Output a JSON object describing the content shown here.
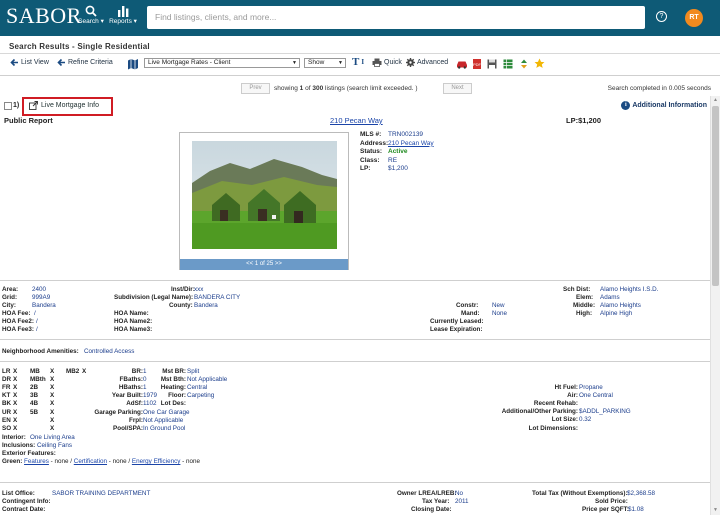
{
  "header": {
    "logo": "SABOR",
    "search_nav_label": "Search",
    "reports_nav_label": "Reports",
    "search_placeholder": "Find listings, clients, and more...",
    "help_label": "?",
    "avatar_initials": "RT",
    "bar_color": "#0e5a76",
    "avatar_color": "#f18a1e"
  },
  "page_title": "Search Results - Single Residential",
  "toolbar": {
    "list_view": "List View",
    "refine_criteria": "Refine Criteria",
    "report_select": "Live Mortgage Rates - Client",
    "show_select": "Show",
    "quick": "Quick",
    "advanced": "Advanced"
  },
  "pager": {
    "prev": "Prev",
    "next": "Next",
    "showing_pre": "showing",
    "current": "1",
    "of": "of",
    "total": "300",
    "showing_post": "listings (search limit exceeded. )",
    "completed": "Search completed in 0.005 seconds"
  },
  "result": {
    "row_number": "1)",
    "live_mortgage": "Live Mortgage Info",
    "additional_info": "Additional Information",
    "report_title": "Public Report",
    "address_link": "210 Pecan Way",
    "lp_header": "LP:$1,200",
    "photo_counter": "<< 1 of 25 >>",
    "facts": [
      {
        "k": "MLS #:",
        "v": "TRN002139",
        "style": "v"
      },
      {
        "k": "Address:",
        "v": "210 Pecan Way",
        "style": "lnk"
      },
      {
        "k": "Status:",
        "v": "Active",
        "style": "active"
      },
      {
        "k": "Class:",
        "v": "RE",
        "style": "v"
      },
      {
        "k": "LP:",
        "v": "$1,200",
        "style": "v"
      }
    ]
  },
  "section1": {
    "area_k": "Area:",
    "area_v": "2400",
    "grid_k": "Grid:",
    "grid_v": "999A9",
    "city_k": "City:",
    "city_v": "Bandera",
    "hoafee_k": "HOA Fee:",
    "hoafee_v": "/",
    "hoafee2_k": "HOA Fee2:",
    "hoafee2_v": "/",
    "hoafee3_k": "HOA Fee3:",
    "hoafee3_v": "/",
    "instdir_k": "Inst/Dir:",
    "instdir_v": "xxx",
    "subdiv_k": "Subdivision (Legal Name):",
    "subdiv_v": "BANDERA CITY",
    "county_k": "County:",
    "county_v": "Bandera",
    "hoaname_k": "HOA Name:",
    "hoaname2_k": "HOA Name2:",
    "hoaname3_k": "HOA Name3:",
    "constr_k": "Constr:",
    "constr_v": "New",
    "mand_k": "Mand:",
    "mand_v": "None",
    "leased_k": "Currently Leased:",
    "leaseexp_k": "Lease Expiration:",
    "schdist_k": "Sch Dist:",
    "schdist_v": "Alamo Heights I.S.D.",
    "elem_k": "Elem:",
    "elem_v": "Adams",
    "middle_k": "Middle:",
    "middle_v": "Alamo Heights",
    "high_k": "High:",
    "high_v": "Alpine High"
  },
  "section2": {
    "amen_k": "Neighborhood Amenities:",
    "amen_v": "Controlled Access"
  },
  "rooms": [
    {
      "a": "LR",
      "b": "X",
      "c": "MB",
      "d": "X",
      "e": "MB2",
      "f": "X"
    },
    {
      "a": "DR",
      "b": "X",
      "c": "MBth",
      "d": "X",
      "e": "",
      "f": ""
    },
    {
      "a": "FR",
      "b": "X",
      "c": "2B",
      "d": "X",
      "e": "",
      "f": ""
    },
    {
      "a": "KT",
      "b": "X",
      "c": "3B",
      "d": "X",
      "e": "",
      "f": ""
    },
    {
      "a": "BK",
      "b": "X",
      "c": "4B",
      "d": "X",
      "e": "",
      "f": ""
    },
    {
      "a": "UR",
      "b": "X",
      "c": "5B",
      "d": "X",
      "e": "",
      "f": ""
    },
    {
      "a": "EN",
      "b": "X",
      "c": "",
      "d": "X",
      "e": "",
      "f": ""
    },
    {
      "a": "SO",
      "b": "X",
      "c": "",
      "d": "X",
      "e": "",
      "f": ""
    }
  ],
  "details_mid": [
    {
      "k": "BR:",
      "v": "1"
    },
    {
      "k": "FBaths:",
      "v": "0"
    },
    {
      "k": "HBaths:",
      "v": "1"
    },
    {
      "k": "Year Built:",
      "v": "1979"
    },
    {
      "k": "AdSf:",
      "v": "1102"
    },
    {
      "k": "Garage Parking:",
      "v": "One Car Garage"
    },
    {
      "k": "Frpl:",
      "v": "Not Applicable"
    },
    {
      "k": "Pool/SPA:",
      "v": "In Ground Pool"
    }
  ],
  "details_mid2": [
    {
      "k": "Mst BR:",
      "v": "Split"
    },
    {
      "k": "Mst Bth:",
      "v": "Not Applicable"
    },
    {
      "k": "Heating:",
      "v": "Central"
    },
    {
      "k": "Floor:",
      "v": "Carpeting"
    },
    {
      "k": "Lot Des:",
      "v": ""
    }
  ],
  "details_right": [
    {
      "k": "Ht Fuel:",
      "v": "Propane"
    },
    {
      "k": "Air:",
      "v": "One Central"
    },
    {
      "k": "Recent Rehab:",
      "v": ""
    },
    {
      "k": "Additional/Other Parking:",
      "v": "$ADDL_PARKING"
    },
    {
      "k": "Lot Size:",
      "v": "0.32"
    },
    {
      "k": "Lot Dimensions:",
      "v": ""
    }
  ],
  "features": {
    "interior_k": "Interior:",
    "interior_v": "One Living Area",
    "inclusions_k": "Inclusions:",
    "inclusions_v": "Ceiling Fans",
    "exterior_k": "Exterior Features:",
    "green_k": "Green:",
    "green_features": "Features",
    "green_certification": "Certification",
    "green_energy": "Energy Efficiency",
    "green_none1": "- none /",
    "green_none2": "- none /",
    "green_none3": "- none"
  },
  "office": {
    "list_office_k": "List Office:",
    "list_office_v": "SABOR TRAINING DEPARTMENT",
    "contingent_k": "Contingent Info:",
    "contract_k": "Contract Date:",
    "owner_k": "Owner LREA/LREB:",
    "owner_v": "No",
    "taxyear_k": "Tax Year:",
    "taxyear_v": "2011",
    "closing_k": "Closing Date:",
    "totaltax_k": "Total Tax (Without Exemptions):",
    "totaltax_v": "$2,368.58",
    "sold_k": "Sold Price:",
    "ppsf_k": "Price per SQFT:",
    "ppsf_v": "$1.08"
  }
}
